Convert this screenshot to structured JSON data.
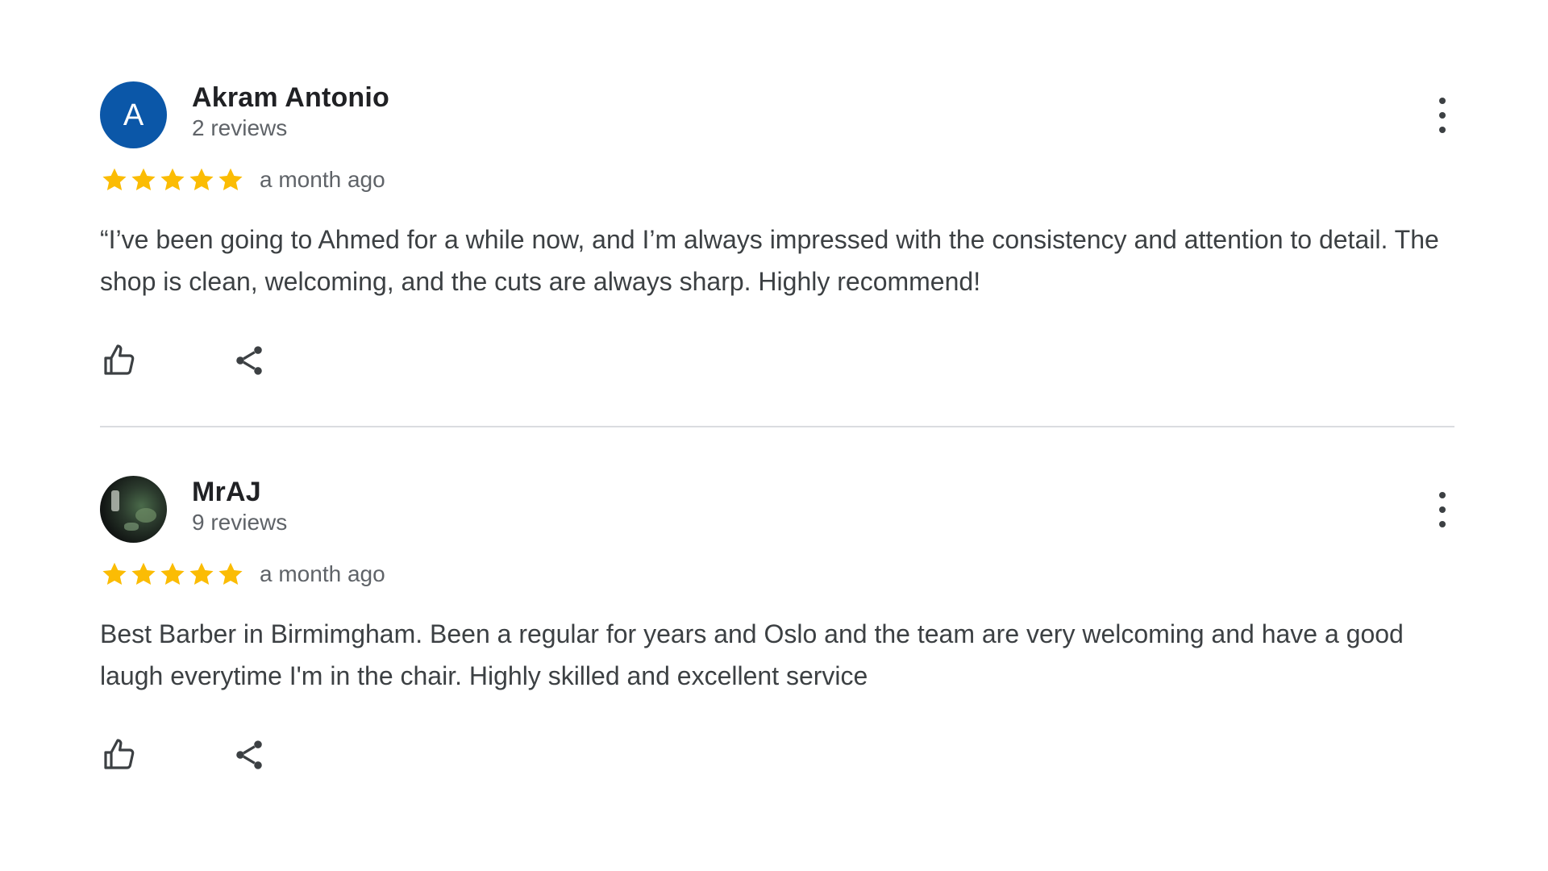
{
  "colors": {
    "star": "#fbbc04",
    "avatar_blue": "#0b57a8",
    "divider": "#dadce0",
    "secondary_text": "#5f6368"
  },
  "icons": {
    "like": "thumbs-up-icon",
    "share": "share-icon",
    "more": "more-vert-icon",
    "star": "star-icon"
  },
  "reviews": [
    {
      "avatar_letter": "A",
      "author": "Akram Antonio",
      "review_count": "2 reviews",
      "rating": 5,
      "date": "a month ago",
      "text": "“I’ve been going to Ahmed for a while now, and I’m always impressed with the consistency and attention to detail. The shop is clean, welcoming, and the cuts are always sharp. Highly recommend!"
    },
    {
      "avatar_letter": "",
      "author": "MrAJ",
      "review_count": "9 reviews",
      "rating": 5,
      "date": "a month ago",
      "text": "Best Barber in Birmimgham. Been a regular for years and Oslo and the team are very welcoming and have a good laugh everytime I'm in the chair. Highly skilled and excellent service"
    }
  ]
}
